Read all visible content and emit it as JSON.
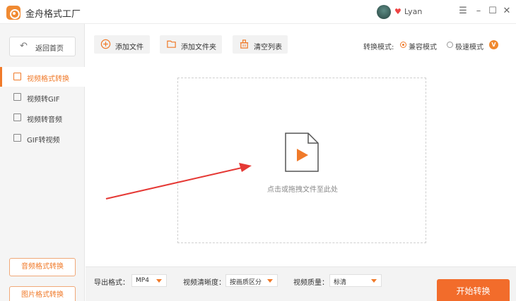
{
  "app": {
    "title": "金舟格式工厂"
  },
  "user": {
    "name": "Lyan"
  },
  "window_controls": {
    "menu": "☰",
    "minimize": "–",
    "maximize": "☐",
    "close": "✕"
  },
  "sidebar": {
    "home_label": "返回首页",
    "items": [
      {
        "label": "视频格式转换",
        "active": true
      },
      {
        "label": "视频转GIF",
        "active": false
      },
      {
        "label": "视频转音频",
        "active": false
      },
      {
        "label": "GIF转视频",
        "active": false
      }
    ],
    "bottom_buttons": [
      "音频格式转换",
      "图片格式转换"
    ]
  },
  "toolbar": {
    "add_file": "添加文件",
    "add_folder": "添加文件夹",
    "clear_list": "清空列表",
    "mode_label": "转换模式:",
    "mode_options": [
      {
        "label": "兼容模式",
        "selected": true
      },
      {
        "label": "极速模式",
        "selected": false
      }
    ],
    "vip_badge": "V"
  },
  "dropzone": {
    "hint": "点击或拖拽文件至此处"
  },
  "output": {
    "format_label": "导出格式：",
    "format_value": "MP4",
    "clarity_label": "视频清晰度：",
    "clarity_value": "按画质区分",
    "quality_label": "视频质量：",
    "quality_value": "标清"
  },
  "start_button": "开始转换",
  "colors": {
    "accent": "#f26c2b",
    "arrow": "#e53935"
  }
}
